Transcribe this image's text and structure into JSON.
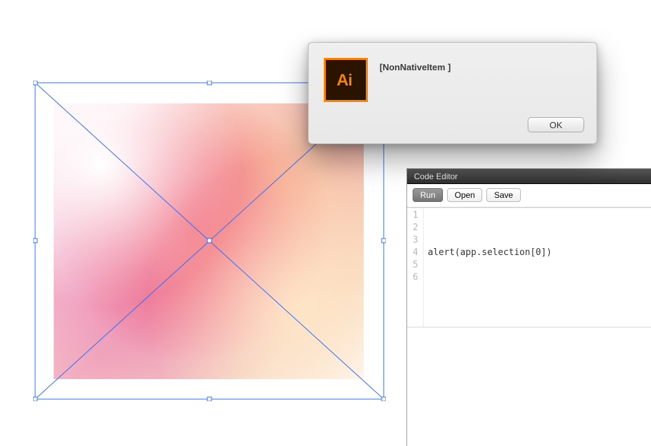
{
  "dialog": {
    "message": "[NonNativeItem ]",
    "ok_label": "OK",
    "app_icon_text": "Ai"
  },
  "code_editor": {
    "title": "Code Editor",
    "buttons": {
      "run": "Run",
      "open": "Open",
      "save": "Save"
    },
    "lines": {
      "1": "",
      "2": "",
      "3": "",
      "4": "alert(app.selection[0])",
      "5": "",
      "6": ""
    },
    "line_numbers": [
      "1",
      "2",
      "3",
      "4",
      "5",
      "6"
    ]
  },
  "colors": {
    "selection_blue": "#2a6cff",
    "ai_orange": "#fa8300",
    "ai_bg": "#2a1400"
  }
}
